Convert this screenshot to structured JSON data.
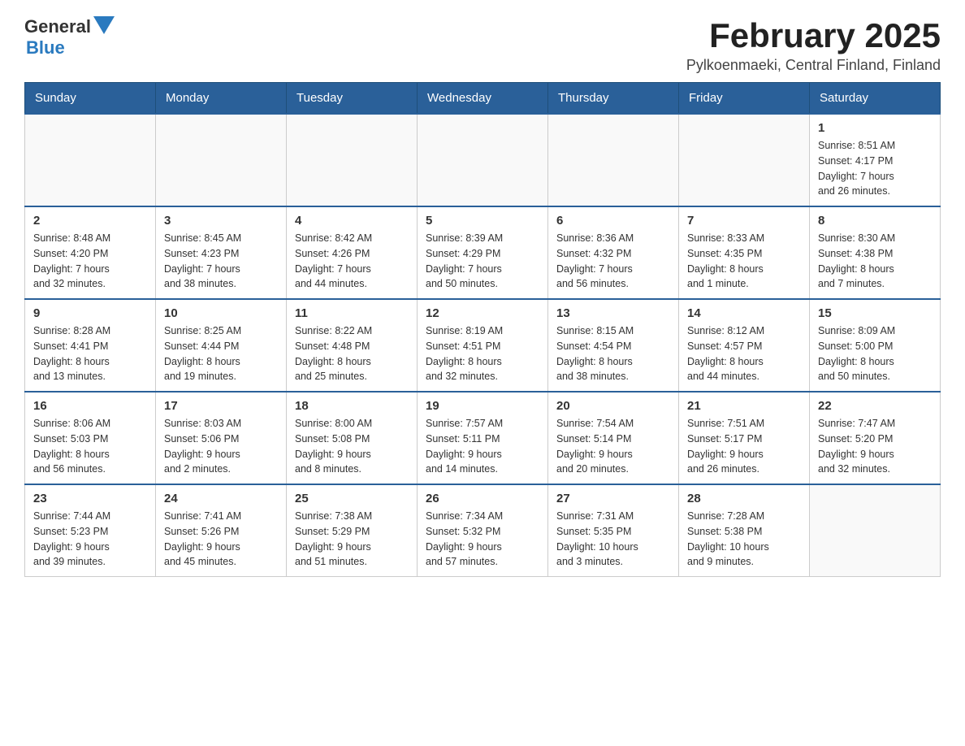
{
  "header": {
    "logo_general": "General",
    "logo_blue": "Blue",
    "month_title": "February 2025",
    "subtitle": "Pylkoenmaeki, Central Finland, Finland"
  },
  "weekdays": [
    "Sunday",
    "Monday",
    "Tuesday",
    "Wednesday",
    "Thursday",
    "Friday",
    "Saturday"
  ],
  "weeks": [
    [
      {
        "day": "",
        "info": ""
      },
      {
        "day": "",
        "info": ""
      },
      {
        "day": "",
        "info": ""
      },
      {
        "day": "",
        "info": ""
      },
      {
        "day": "",
        "info": ""
      },
      {
        "day": "",
        "info": ""
      },
      {
        "day": "1",
        "info": "Sunrise: 8:51 AM\nSunset: 4:17 PM\nDaylight: 7 hours\nand 26 minutes."
      }
    ],
    [
      {
        "day": "2",
        "info": "Sunrise: 8:48 AM\nSunset: 4:20 PM\nDaylight: 7 hours\nand 32 minutes."
      },
      {
        "day": "3",
        "info": "Sunrise: 8:45 AM\nSunset: 4:23 PM\nDaylight: 7 hours\nand 38 minutes."
      },
      {
        "day": "4",
        "info": "Sunrise: 8:42 AM\nSunset: 4:26 PM\nDaylight: 7 hours\nand 44 minutes."
      },
      {
        "day": "5",
        "info": "Sunrise: 8:39 AM\nSunset: 4:29 PM\nDaylight: 7 hours\nand 50 minutes."
      },
      {
        "day": "6",
        "info": "Sunrise: 8:36 AM\nSunset: 4:32 PM\nDaylight: 7 hours\nand 56 minutes."
      },
      {
        "day": "7",
        "info": "Sunrise: 8:33 AM\nSunset: 4:35 PM\nDaylight: 8 hours\nand 1 minute."
      },
      {
        "day": "8",
        "info": "Sunrise: 8:30 AM\nSunset: 4:38 PM\nDaylight: 8 hours\nand 7 minutes."
      }
    ],
    [
      {
        "day": "9",
        "info": "Sunrise: 8:28 AM\nSunset: 4:41 PM\nDaylight: 8 hours\nand 13 minutes."
      },
      {
        "day": "10",
        "info": "Sunrise: 8:25 AM\nSunset: 4:44 PM\nDaylight: 8 hours\nand 19 minutes."
      },
      {
        "day": "11",
        "info": "Sunrise: 8:22 AM\nSunset: 4:48 PM\nDaylight: 8 hours\nand 25 minutes."
      },
      {
        "day": "12",
        "info": "Sunrise: 8:19 AM\nSunset: 4:51 PM\nDaylight: 8 hours\nand 32 minutes."
      },
      {
        "day": "13",
        "info": "Sunrise: 8:15 AM\nSunset: 4:54 PM\nDaylight: 8 hours\nand 38 minutes."
      },
      {
        "day": "14",
        "info": "Sunrise: 8:12 AM\nSunset: 4:57 PM\nDaylight: 8 hours\nand 44 minutes."
      },
      {
        "day": "15",
        "info": "Sunrise: 8:09 AM\nSunset: 5:00 PM\nDaylight: 8 hours\nand 50 minutes."
      }
    ],
    [
      {
        "day": "16",
        "info": "Sunrise: 8:06 AM\nSunset: 5:03 PM\nDaylight: 8 hours\nand 56 minutes."
      },
      {
        "day": "17",
        "info": "Sunrise: 8:03 AM\nSunset: 5:06 PM\nDaylight: 9 hours\nand 2 minutes."
      },
      {
        "day": "18",
        "info": "Sunrise: 8:00 AM\nSunset: 5:08 PM\nDaylight: 9 hours\nand 8 minutes."
      },
      {
        "day": "19",
        "info": "Sunrise: 7:57 AM\nSunset: 5:11 PM\nDaylight: 9 hours\nand 14 minutes."
      },
      {
        "day": "20",
        "info": "Sunrise: 7:54 AM\nSunset: 5:14 PM\nDaylight: 9 hours\nand 20 minutes."
      },
      {
        "day": "21",
        "info": "Sunrise: 7:51 AM\nSunset: 5:17 PM\nDaylight: 9 hours\nand 26 minutes."
      },
      {
        "day": "22",
        "info": "Sunrise: 7:47 AM\nSunset: 5:20 PM\nDaylight: 9 hours\nand 32 minutes."
      }
    ],
    [
      {
        "day": "23",
        "info": "Sunrise: 7:44 AM\nSunset: 5:23 PM\nDaylight: 9 hours\nand 39 minutes."
      },
      {
        "day": "24",
        "info": "Sunrise: 7:41 AM\nSunset: 5:26 PM\nDaylight: 9 hours\nand 45 minutes."
      },
      {
        "day": "25",
        "info": "Sunrise: 7:38 AM\nSunset: 5:29 PM\nDaylight: 9 hours\nand 51 minutes."
      },
      {
        "day": "26",
        "info": "Sunrise: 7:34 AM\nSunset: 5:32 PM\nDaylight: 9 hours\nand 57 minutes."
      },
      {
        "day": "27",
        "info": "Sunrise: 7:31 AM\nSunset: 5:35 PM\nDaylight: 10 hours\nand 3 minutes."
      },
      {
        "day": "28",
        "info": "Sunrise: 7:28 AM\nSunset: 5:38 PM\nDaylight: 10 hours\nand 9 minutes."
      },
      {
        "day": "",
        "info": ""
      }
    ]
  ]
}
